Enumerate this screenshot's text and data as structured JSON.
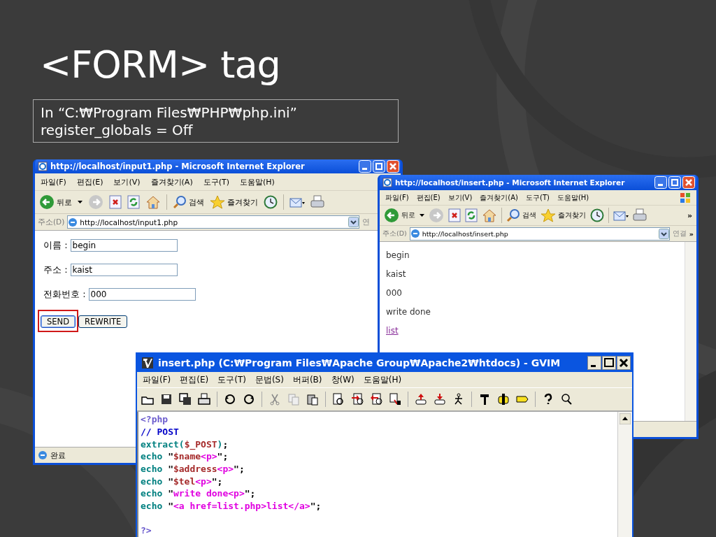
{
  "slide": {
    "title": "<FORM> tag",
    "note_lines": [
      "In “C:₩Program Files₩PHP₩php.ini”",
      "register_globals = Off"
    ]
  },
  "input_window": {
    "title": "http://localhost/input1.php - Microsoft Internet Explorer",
    "menu": [
      "파일(F)",
      "편집(E)",
      "보기(V)",
      "즐겨찾기(A)",
      "도구(T)",
      "도움말(H)"
    ],
    "toolbar": {
      "back": "뒤로",
      "search": "검색",
      "favorites": "즐겨찾기"
    },
    "address_label": "주소(D)",
    "url": "http://localhost/input1.php",
    "links_label": "연",
    "fields": [
      {
        "label": "이름 :",
        "value": "begin"
      },
      {
        "label": "주소 :",
        "value": "kaist"
      },
      {
        "label": "전화번호 :",
        "value": "000"
      }
    ],
    "buttons": [
      {
        "label": "SEND",
        "highlighted": true
      },
      {
        "label": "REWRITE",
        "highlighted": false
      }
    ],
    "status": "완료"
  },
  "result_window": {
    "title": "http://localhost/insert.php - Microsoft Internet Explorer",
    "menu": [
      "파일(F)",
      "편집(E)",
      "보기(V)",
      "즐겨찾기(A)",
      "도구(T)",
      "도움말(H)"
    ],
    "toolbar": {
      "back": "뒤로",
      "search": "검색",
      "favorites": "즐겨찾기",
      "more": "»"
    },
    "address_label": "주소(D)",
    "url": "http://localhost/insert.php",
    "links_label": "연결",
    "links_more": "»",
    "output": [
      {
        "text": "begin",
        "kind": "text"
      },
      {
        "text": "kaist",
        "kind": "text"
      },
      {
        "text": "000",
        "kind": "text"
      },
      {
        "text": "write done",
        "kind": "text"
      },
      {
        "text": "list",
        "kind": "link"
      }
    ]
  },
  "editor_window": {
    "title": "insert.php (C:₩Program Files₩Apache Group₩Apache2₩htdocs) - GVIM",
    "menu": [
      "파일(F)",
      "편집(E)",
      "도구(T)",
      "문법(S)",
      "버퍼(B)",
      "창(W)",
      "도움말(H)"
    ],
    "code_lines": [
      {
        "tokens": [
          {
            "text": "<?php",
            "kind": "preproc"
          }
        ]
      },
      {
        "tokens": [
          {
            "text": "// POST",
            "kind": "comment"
          }
        ]
      },
      {
        "tokens": [
          {
            "text": "extract(",
            "kind": "func"
          },
          {
            "text": "$_POST",
            "kind": "var"
          },
          {
            "text": ")",
            "kind": "func"
          },
          {
            "text": ";",
            "kind": "plain"
          }
        ]
      },
      {
        "tokens": [
          {
            "text": "echo",
            "kind": "func"
          },
          {
            "text": " \"",
            "kind": "plain"
          },
          {
            "text": "$name",
            "kind": "var"
          },
          {
            "text": "<p>",
            "kind": "string"
          },
          {
            "text": "\";",
            "kind": "plain"
          }
        ]
      },
      {
        "tokens": [
          {
            "text": "echo",
            "kind": "func"
          },
          {
            "text": " \"",
            "kind": "plain"
          },
          {
            "text": "$address",
            "kind": "var"
          },
          {
            "text": "<p>",
            "kind": "string"
          },
          {
            "text": "\";",
            "kind": "plain"
          }
        ]
      },
      {
        "tokens": [
          {
            "text": "echo",
            "kind": "func"
          },
          {
            "text": " \"",
            "kind": "plain"
          },
          {
            "text": "$tel",
            "kind": "var"
          },
          {
            "text": "<p>",
            "kind": "string"
          },
          {
            "text": "\";",
            "kind": "plain"
          }
        ]
      },
      {
        "tokens": [
          {
            "text": "echo",
            "kind": "func"
          },
          {
            "text": " \"",
            "kind": "plain"
          },
          {
            "text": "write done<p>",
            "kind": "string"
          },
          {
            "text": "\";",
            "kind": "plain"
          }
        ]
      },
      {
        "tokens": [
          {
            "text": "echo",
            "kind": "func"
          },
          {
            "text": " \"",
            "kind": "plain"
          },
          {
            "text": "<a href=list.php>list</a>",
            "kind": "string"
          },
          {
            "text": "\";",
            "kind": "plain"
          }
        ]
      },
      {
        "kind": "blank"
      },
      {
        "tokens": [
          {
            "text": "?>",
            "kind": "preproc"
          }
        ]
      }
    ]
  }
}
